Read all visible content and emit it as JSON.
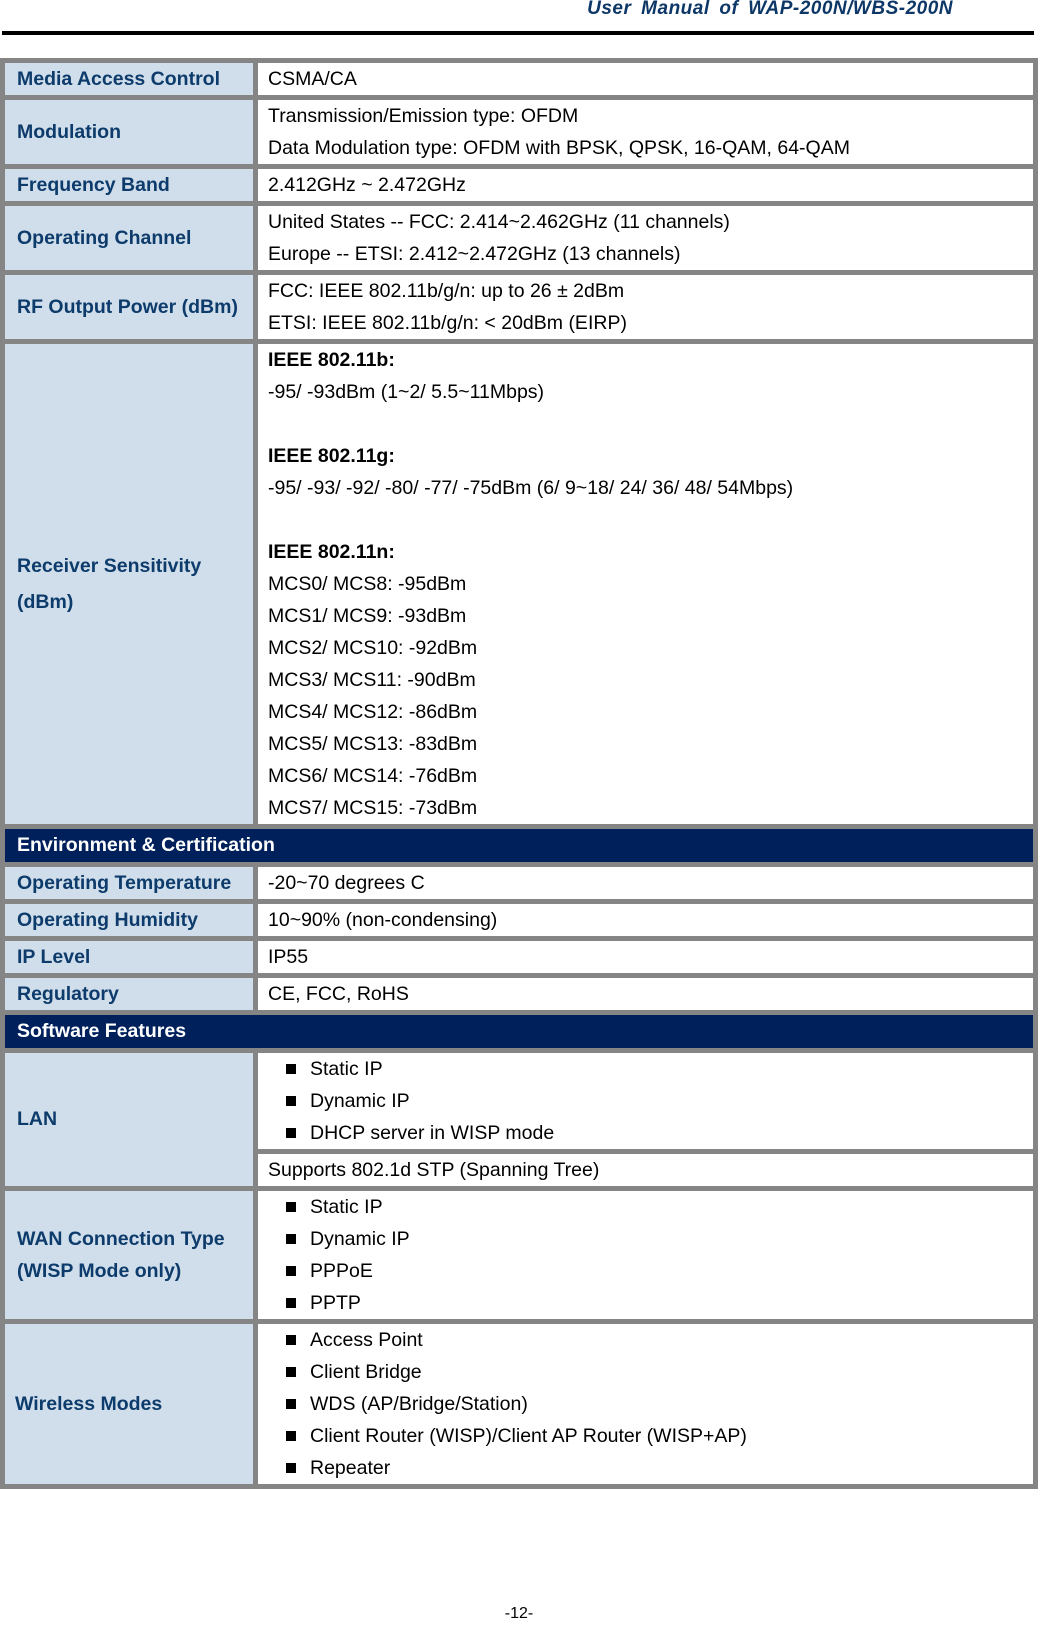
{
  "header": {
    "title": "User  Manual  of  WAP-200N/WBS-200N"
  },
  "rows": {
    "mac": {
      "label": "Media Access Control",
      "value": "CSMA/CA"
    },
    "modulation": {
      "label": "Modulation",
      "lines": [
        "Transmission/Emission type: OFDM",
        "Data Modulation type: OFDM with BPSK, QPSK, 16-QAM, 64-QAM"
      ]
    },
    "frequency": {
      "label": "Frequency Band",
      "value": "2.412GHz ~ 2.472GHz"
    },
    "channel": {
      "label": "Operating Channel",
      "lines": [
        "United States -- FCC: 2.414~2.462GHz (11 channels)",
        "Europe -- ETSI: 2.412~2.472GHz (13 channels)"
      ]
    },
    "rf_power": {
      "label": "RF Output Power (dBm)",
      "lines": [
        "FCC: IEEE 802.11b/g/n: up to 26 ± 2dBm",
        "ETSI: IEEE 802.11b/g/n: < 20dBm (EIRP)"
      ]
    },
    "sensitivity": {
      "label_line1": "Receiver Sensitivity",
      "label_line2": "(dBm)",
      "b_head": "IEEE 802.11b:",
      "b_value": "-95/ -93dBm (1~2/ 5.5~11Mbps)",
      "g_head": "IEEE 802.11g:",
      "g_value": "-95/ -93/ -92/ -80/ -77/ -75dBm (6/ 9~18/ 24/ 36/ 48/ 54Mbps)",
      "n_head": "IEEE 802.11n:",
      "n_values": [
        "MCS0/ MCS8: -95dBm",
        "MCS1/ MCS9: -93dBm",
        "MCS2/ MCS10: -92dBm",
        "MCS3/ MCS11: -90dBm",
        "MCS4/ MCS12: -86dBm",
        "MCS5/ MCS13: -83dBm",
        "MCS6/ MCS14: -76dBm",
        "MCS7/ MCS15: -73dBm"
      ]
    }
  },
  "sections": {
    "environment": {
      "title": "Environment & Certification",
      "rows": [
        {
          "label": "Operating Temperature",
          "value": "-20~70 degrees C"
        },
        {
          "label": "Operating Humidity",
          "value": "10~90% (non-condensing)"
        },
        {
          "label": "IP Level",
          "value": "IP55"
        },
        {
          "label": "Regulatory",
          "value": "CE, FCC, RoHS"
        }
      ]
    },
    "software": {
      "title": "Software Features",
      "lan": {
        "label": "LAN",
        "bullets": [
          "Static IP",
          "Dynamic IP",
          "DHCP server in WISP mode"
        ],
        "extra": "Supports 802.1d STP (Spanning Tree)"
      },
      "wan": {
        "label_line1": "WAN Connection Type",
        "label_line2": "(WISP Mode only)",
        "bullets": [
          "Static IP",
          "Dynamic IP",
          "PPPoE",
          "PPTP"
        ]
      },
      "wireless": {
        "label": "Wireless Modes",
        "bullets": [
          "Access Point",
          "Client Bridge",
          "WDS (AP/Bridge/Station)",
          "Client Router (WISP)/Client AP Router (WISP+AP)",
          "Repeater"
        ]
      }
    }
  },
  "footer": {
    "page_number": "-12-"
  },
  "colors": {
    "label_bg": "#cfdeea",
    "label_text": "#0d3b6b",
    "section_bg": "#00205c",
    "border": "#858585"
  }
}
